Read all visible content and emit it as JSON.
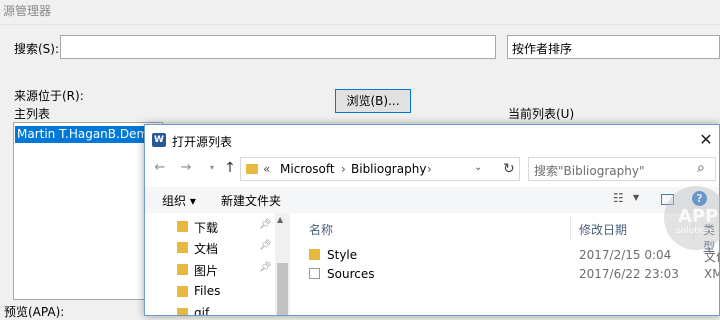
{
  "source_manager": {
    "title": "源管理器",
    "search_label": "搜索(S):",
    "search_value": "",
    "sort_value": "按作者排序",
    "source_location_label": "来源位于(R):",
    "master_list_label": "主列表",
    "browse_label": "浏览(B)...",
    "current_list_label": "当前列表(U)",
    "master_list_items": [
      "Martin T.HaganB.Demuth"
    ],
    "preview_label": "预览(APA):"
  },
  "file_dialog": {
    "title": "打开源列表",
    "close_glyph": "✕",
    "address": {
      "overflow": "«",
      "crumbs": [
        "Microsoft",
        "Bibliography"
      ],
      "separator": "›"
    },
    "search_placeholder": "搜索\"Bibliography\"",
    "toolbar": {
      "organize": "组织 ▾",
      "new_folder": "新建文件夹"
    },
    "nav_items": [
      {
        "label": "下载",
        "pinned": true
      },
      {
        "label": "文档",
        "pinned": true
      },
      {
        "label": "图片",
        "pinned": true
      },
      {
        "label": "Files",
        "pinned": false
      },
      {
        "label": "gif",
        "pinned": false
      }
    ],
    "columns": {
      "name": "名称",
      "modified": "修改日期",
      "type": "类型"
    },
    "files": [
      {
        "name": "Style",
        "modified": "2017/2/15 0:04",
        "type": "文件",
        "icon": "folder-icon"
      },
      {
        "name": "Sources",
        "modified": "2017/6/22 23:03",
        "type": "XM",
        "icon": "document-icon"
      }
    ]
  },
  "watermark": {
    "line1": "APP",
    "line2": "solution"
  },
  "colors": {
    "accent": "#0078d7",
    "folder": "#e8b940",
    "word": "#2b579a"
  }
}
